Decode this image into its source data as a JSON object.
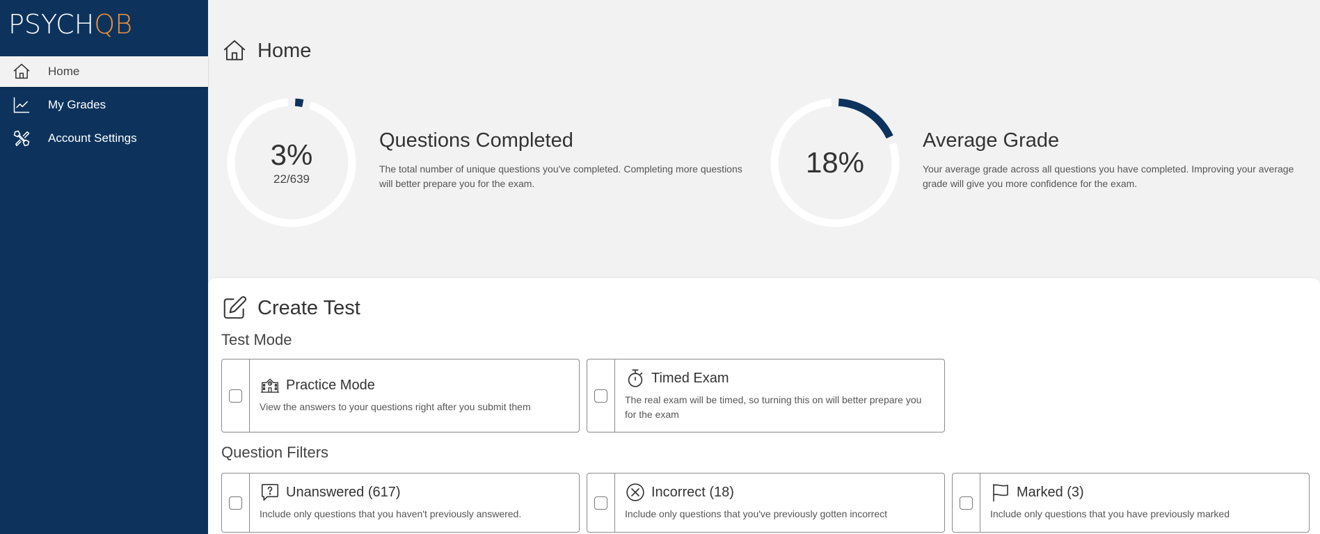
{
  "brand": {
    "name_main": "PSYCH",
    "name_accent": "QB",
    "accent_color": "#f0913a",
    "sidebar_color": "#0d335d"
  },
  "sidebar": {
    "items": [
      {
        "label": "Home",
        "icon": "home-icon",
        "active": true
      },
      {
        "label": "My Grades",
        "icon": "chart-line-icon",
        "active": false
      },
      {
        "label": "Account Settings",
        "icon": "tools-icon",
        "active": false
      }
    ]
  },
  "page": {
    "title": "Home",
    "icon": "home-icon"
  },
  "stats": {
    "questions_completed": {
      "percent_label": "3%",
      "fraction": "22/639",
      "progress": 0.03,
      "title": "Questions Completed",
      "description": "The total number of unique questions you've completed. Completing more questions will better prepare you for the exam."
    },
    "average_grade": {
      "percent_label": "18%",
      "progress": 0.18,
      "title": "Average Grade",
      "description": "Your average grade across all questions you have completed. Improving your average grade will give you more confidence for the exam."
    }
  },
  "create_test": {
    "title": "Create Test",
    "icon": "edit-icon",
    "test_mode_label": "Test Mode",
    "modes": [
      {
        "title": "Practice Mode",
        "icon": "school-icon",
        "description": "View the answers to your questions right after you submit them",
        "checked": false
      },
      {
        "title": "Timed Exam",
        "icon": "stopwatch-icon",
        "description": "The real exam will be timed, so turning this on will better prepare you for the exam",
        "checked": false
      }
    ],
    "filters_label": "Question Filters",
    "filters": [
      {
        "title": "Unanswered (617)",
        "icon": "question-bubble-icon",
        "description": "Include only questions that you haven't previously answered.",
        "checked": false
      },
      {
        "title": "Incorrect (18)",
        "icon": "x-circle-icon",
        "description": "Include only questions that you've previously gotten incorrect",
        "checked": false
      },
      {
        "title": "Marked (3)",
        "icon": "flag-icon",
        "description": "Include only questions that you have previously marked",
        "checked": false
      }
    ]
  }
}
